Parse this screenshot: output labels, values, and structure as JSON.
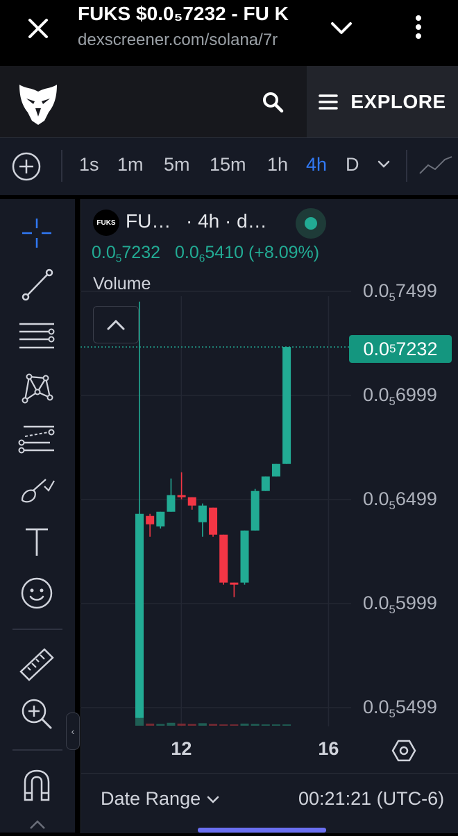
{
  "browser": {
    "title": "FUKS $0.0₅7232 - FU K",
    "url": "dexscreener.com/solana/7r",
    "icons": [
      "close-icon",
      "chevron-down-icon",
      "more-vertical-icon"
    ]
  },
  "header": {
    "logo_icon": "eagle-logo-icon",
    "search_icon": "search-icon",
    "explore_label": "EXPLORE"
  },
  "toolbar": {
    "timeframes": [
      "1s",
      "1m",
      "5m",
      "15m",
      "1h",
      "4h",
      "D"
    ],
    "active_timeframe": "4h",
    "accent": "#3179f5"
  },
  "tools": [
    "crosshair-icon",
    "trend-line-icon",
    "horizontal-lines-icon",
    "pattern-icon",
    "fib-icon",
    "brush-icon",
    "text-icon",
    "emoji-icon",
    "ruler-icon",
    "zoom-in-icon",
    "magnet-icon"
  ],
  "legend": {
    "badge": "FUKS",
    "symbol": "FU…",
    "meta": "· 4h · d…",
    "price_base": "0.0",
    "price_sub": "5",
    "price_rest": "7232",
    "change_base": "0.0",
    "change_sub": "6",
    "change_rest": "5410 (+8.09%)",
    "volume_label": "Volume"
  },
  "chart_data": {
    "type": "candlestick",
    "y_unit": "price × 1e-5",
    "ylim": [
      0.535,
      0.775
    ],
    "y_ticks": [
      {
        "value": 0.7499,
        "base": "0.0",
        "sub": "5",
        "rest": "7499"
      },
      {
        "value": 0.6999,
        "base": "0.0",
        "sub": "5",
        "rest": "6999"
      },
      {
        "value": 0.6499,
        "base": "0.0",
        "sub": "5",
        "rest": "6499"
      },
      {
        "value": 0.5999,
        "base": "0.0",
        "sub": "5",
        "rest": "5999"
      },
      {
        "value": 0.5499,
        "base": "0.0",
        "sub": "5",
        "rest": "5499"
      }
    ],
    "last_price": {
      "value": 0.7232,
      "base": "0.0",
      "sub": "5",
      "rest": "7232"
    },
    "x_ticks": [
      {
        "label": "12",
        "index": 2
      },
      {
        "label": "16",
        "index": 16
      }
    ],
    "candles": [
      {
        "o": 0.545,
        "h": 0.745,
        "l": 0.545,
        "c": 0.643
      },
      {
        "o": 0.642,
        "h": 0.643,
        "l": 0.632,
        "c": 0.638
      },
      {
        "o": 0.637,
        "h": 0.644,
        "l": 0.636,
        "c": 0.644
      },
      {
        "o": 0.644,
        "h": 0.66,
        "l": 0.644,
        "c": 0.652
      },
      {
        "o": 0.652,
        "h": 0.663,
        "l": 0.65,
        "c": 0.651
      },
      {
        "o": 0.651,
        "h": 0.651,
        "l": 0.645,
        "c": 0.647
      },
      {
        "o": 0.639,
        "h": 0.648,
        "l": 0.632,
        "c": 0.647
      },
      {
        "o": 0.646,
        "h": 0.646,
        "l": 0.632,
        "c": 0.633
      },
      {
        "o": 0.633,
        "h": 0.633,
        "l": 0.609,
        "c": 0.61
      },
      {
        "o": 0.61,
        "h": 0.61,
        "l": 0.603,
        "c": 0.609
      },
      {
        "o": 0.61,
        "h": 0.635,
        "l": 0.609,
        "c": 0.635
      },
      {
        "o": 0.635,
        "h": 0.655,
        "l": 0.635,
        "c": 0.654
      },
      {
        "o": 0.654,
        "h": 0.661,
        "l": 0.654,
        "c": 0.661
      },
      {
        "o": 0.661,
        "h": 0.667,
        "l": 0.661,
        "c": 0.667
      },
      {
        "o": 0.667,
        "h": 0.723,
        "l": 0.667,
        "c": 0.7232
      }
    ],
    "volumes": [
      0.85,
      0.05,
      0.04,
      0.07,
      0.05,
      0.04,
      0.06,
      0.04,
      0.03,
      0.03,
      0.05,
      0.04,
      0.03,
      0.03,
      0.03
    ],
    "colors": {
      "up": "#22ab94",
      "down": "#f23645",
      "grid": "#232733"
    }
  },
  "footer": {
    "date_range_label": "Date Range",
    "clock": "00:21:21 (UTC-6)",
    "settings_icon": "settings-hexagon-icon"
  }
}
